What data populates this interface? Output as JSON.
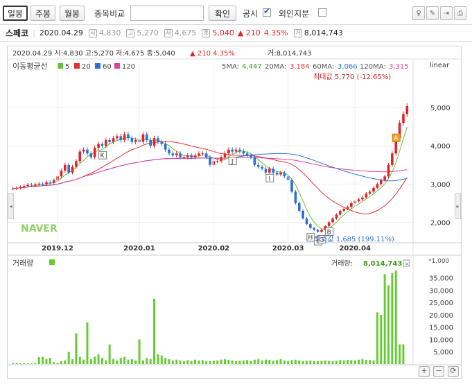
{
  "toolbar": {
    "tabs": [
      {
        "label": "일봉",
        "active": true
      },
      {
        "label": "주봉",
        "active": false
      },
      {
        "label": "월봉",
        "active": false
      }
    ],
    "compare_label": "종목비교",
    "compare_value": "",
    "confirm_label": "확인",
    "disclosure_label": "공시",
    "disclosure_checked": true,
    "foreign_label": "외인지분",
    "foreign_checked": false
  },
  "stock": {
    "name": "스페코",
    "date": "2020.04.29",
    "open": "4,830",
    "high": "5,270",
    "low": "4,675",
    "close": "5,040",
    "change": "▲ 210",
    "change_pct": "4.35%",
    "volume": "8,014,743"
  },
  "chart_header": {
    "line": "2020.04.29 시:4,830 고:5,270 저:4,675 종:5,040",
    "change": "▲  210  4.35%",
    "volume": "거:8,014,743"
  },
  "legend": {
    "title": "이동평균선",
    "items": [
      {
        "label": "5",
        "color": "#6abf3a"
      },
      {
        "label": "20",
        "color": "#e03030"
      },
      {
        "label": "60",
        "color": "#2c6fd6"
      },
      {
        "label": "120",
        "color": "#e040a0"
      }
    ]
  },
  "ma_readout": [
    {
      "label": "5MA:",
      "value": "4,447",
      "color": "#3a9a1a"
    },
    {
      "label": "20MA:",
      "value": "3,184",
      "color": "#e03030"
    },
    {
      "label": "60MA:",
      "value": "3,066",
      "color": "#2c6fd6"
    },
    {
      "label": "120MA:",
      "value": "3,315",
      "color": "#e040a0"
    }
  ],
  "scale_label": "linear",
  "max_label": "최대값 5,770 (-12.65%)",
  "min_label": "최소값 1,685 (199.11%)",
  "watermark": "NAVER",
  "volume_title": "거래량",
  "volume_readout_label": "거래량:",
  "volume_readout_value": "8,014,743",
  "volume_multiplier": "*1,000",
  "colors": {
    "up": "#e0252a",
    "down": "#2c6fd6",
    "volume": "#66cc33"
  },
  "chart_data": {
    "type": "candlestick",
    "x_ticks": [
      "2019.12",
      "2020.01",
      "2020.02",
      "2020.03",
      "2020.04"
    ],
    "price_ticks": [
      2000,
      3000,
      4000,
      5000
    ],
    "price_range": [
      1500,
      6000
    ],
    "volume_ticks": [
      5000,
      10000,
      15000,
      20000,
      25000,
      30000,
      35000
    ],
    "volume_range": [
      0,
      38000
    ],
    "event_markers": [
      "K",
      "J",
      "I",
      "H",
      "F",
      "G",
      "B",
      "A"
    ],
    "closes": [
      2880,
      2900,
      2920,
      2950,
      2980,
      2960,
      2990,
      3010,
      3000,
      3050,
      3030,
      3100,
      3200,
      3350,
      3500,
      3300,
      3450,
      3600,
      3850,
      3900,
      3800,
      3700,
      3950,
      4050,
      4000,
      4150,
      4100,
      4200,
      4250,
      4150,
      4300,
      4200,
      4100,
      4150,
      4100,
      4300,
      4150,
      4000,
      4200,
      4100,
      4050,
      3900,
      3800,
      3750,
      3800,
      3700,
      3700,
      3750,
      3700,
      3750,
      3800,
      3800,
      3700,
      3500,
      3600,
      3600,
      3700,
      3800,
      3900,
      3850,
      3900,
      3850,
      3800,
      3750,
      3700,
      3500,
      3450,
      3400,
      3300,
      3400,
      3300,
      3250,
      3300,
      3200,
      3100,
      2800,
      2500,
      2300,
      2100,
      1950,
      1850,
      1800,
      1750,
      1800,
      1900,
      2000,
      2100,
      2200,
      2300,
      2350,
      2400,
      2500,
      2550,
      2600,
      2650,
      2750,
      2800,
      2900,
      3000,
      3100,
      3200,
      3500,
      3800,
      4200,
      4600,
      4830,
      5040
    ],
    "volumes": [
      400,
      500,
      300,
      400,
      300,
      350,
      400,
      2800,
      3000,
      2000,
      2500,
      800,
      500,
      1200,
      1500,
      5000,
      2000,
      12500,
      3000,
      1800,
      17000,
      2000,
      3000,
      4000,
      2500,
      1500,
      8000,
      2000,
      1500,
      2500,
      3000,
      1800,
      2000,
      1500,
      10000,
      1500,
      2500,
      2000,
      26500,
      4000,
      3500,
      2500,
      2000,
      1500,
      1800,
      1500,
      1200,
      1600,
      1300,
      1800,
      1500,
      1600,
      1200,
      1300,
      1400,
      1500,
      1800,
      2000,
      1700,
      1500,
      1300,
      1400,
      1500,
      1600,
      1300,
      1800,
      2000,
      1500,
      1800,
      1700,
      1400,
      1600,
      2000,
      1500,
      1300,
      1600,
      1800,
      1500,
      1200,
      1400,
      1500,
      1300,
      1200,
      1400,
      1500,
      1300,
      1200,
      1400,
      1600,
      1500,
      1700,
      1600,
      1500,
      1800,
      2000,
      1700,
      1600,
      1500,
      21000,
      20000,
      36500,
      32000,
      37000,
      38000,
      8000,
      8014
    ]
  }
}
